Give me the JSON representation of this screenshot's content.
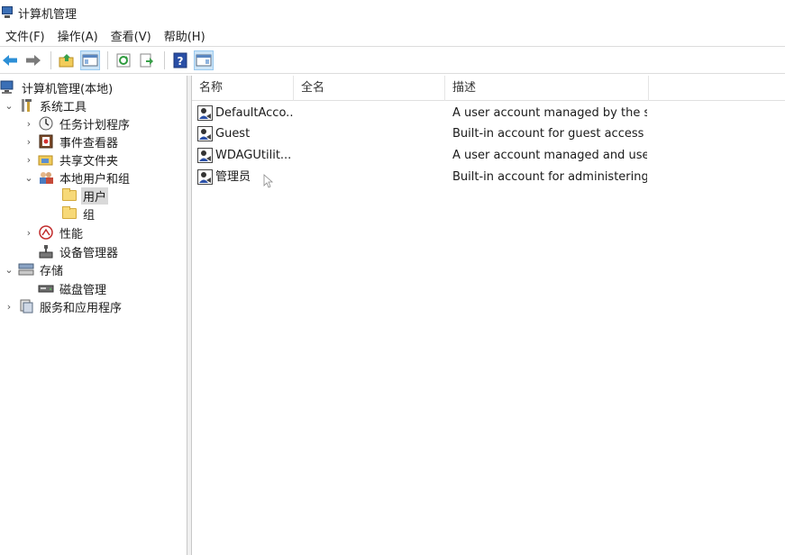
{
  "window": {
    "title": "计算机管理"
  },
  "menu": [
    "文件(F)",
    "操作(A)",
    "查看(V)",
    "帮助(H)"
  ],
  "toolbar": {
    "icons": [
      "back-arrow-icon",
      "forward-arrow-icon",
      "up-folder-icon",
      "show-hide-tree-icon",
      "refresh-icon",
      "export-list-icon",
      "help-icon",
      "show-action-pane-icon"
    ]
  },
  "tree": {
    "root": "计算机管理(本地)",
    "system_tools": "系统工具",
    "task_scheduler": "任务计划程序",
    "event_viewer": "事件查看器",
    "shared_folders": "共享文件夹",
    "local_users_groups": "本地用户和组",
    "users": "用户",
    "groups": "组",
    "performance": "性能",
    "device_manager": "设备管理器",
    "storage": "存储",
    "disk_management": "磁盘管理",
    "services_apps": "服务和应用程序"
  },
  "list": {
    "columns": [
      "名称",
      "全名",
      "描述"
    ],
    "rows": [
      {
        "name": "DefaultAcco...",
        "full_name": "",
        "description": "A user account managed by the s..."
      },
      {
        "name": "Guest",
        "full_name": "",
        "description": "Built-in account for guest access t..."
      },
      {
        "name": "WDAGUtilit...",
        "full_name": "",
        "description": "A user account managed and use..."
      },
      {
        "name": "管理员",
        "full_name": "",
        "description": "Built-in account for administering..."
      }
    ]
  },
  "colors": {
    "selection": "#d9d9d9",
    "toolbar_active": "#cce4f7"
  }
}
